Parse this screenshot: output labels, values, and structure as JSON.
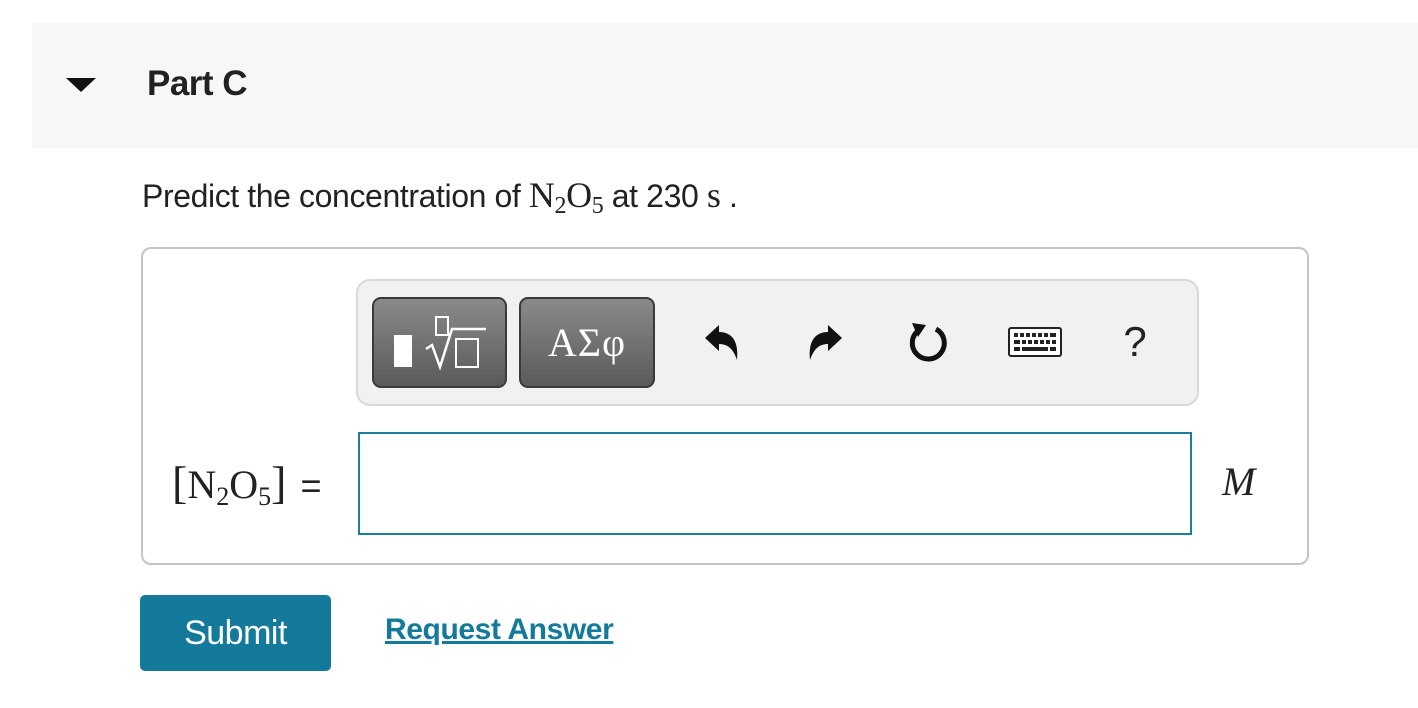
{
  "part": {
    "title": "Part C",
    "caret_icon": "caret-down-icon"
  },
  "question": {
    "prefix": "Predict the concentration of ",
    "species_n": "N",
    "species_n_sub": "2",
    "species_o": "O",
    "species_o_sub": "5",
    "middle": " at 230 ",
    "unit": "s",
    "suffix": " ."
  },
  "toolbar": {
    "templates_icon": "templates-radical-icon",
    "greek_label": "ΑΣφ",
    "undo_icon": "undo-icon",
    "redo_icon": "redo-icon",
    "reset_icon": "reset-icon",
    "keyboard_icon": "keyboard-icon",
    "help_label": "?"
  },
  "answer": {
    "label_open": "[",
    "label_n": "N",
    "label_n_sub": "2",
    "label_o": "O",
    "label_o_sub": "5",
    "label_close": "]",
    "label_eq": "=",
    "value": "",
    "unit": "M"
  },
  "actions": {
    "submit_label": "Submit",
    "request_label": "Request Answer"
  },
  "colors": {
    "accent": "#147a9c",
    "header_bg": "#f7f7f7",
    "toolbar_bg": "#f1f1f1"
  }
}
